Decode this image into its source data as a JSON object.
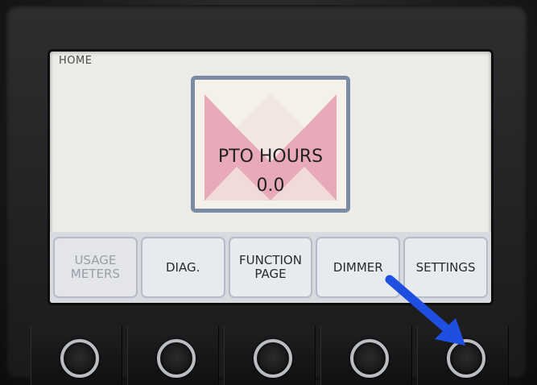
{
  "screen": {
    "title": "HOME",
    "pto_label": "PTO HOURS",
    "pto_value": "0.0"
  },
  "softkeys": [
    {
      "label": "USAGE\nMETERS",
      "enabled": false
    },
    {
      "label": "DIAG.",
      "enabled": true
    },
    {
      "label": "FUNCTION\nPAGE",
      "enabled": true
    },
    {
      "label": "DIMMER",
      "enabled": true
    },
    {
      "label": "SETTINGS",
      "enabled": true
    }
  ],
  "colors": {
    "logo": "#e8a9b8",
    "logo_frame": "#7a8ba3",
    "arrow": "#1f4fe0"
  },
  "icons": {
    "logo": "crown-logo-icon",
    "arrow": "pointer-arrow-icon"
  }
}
